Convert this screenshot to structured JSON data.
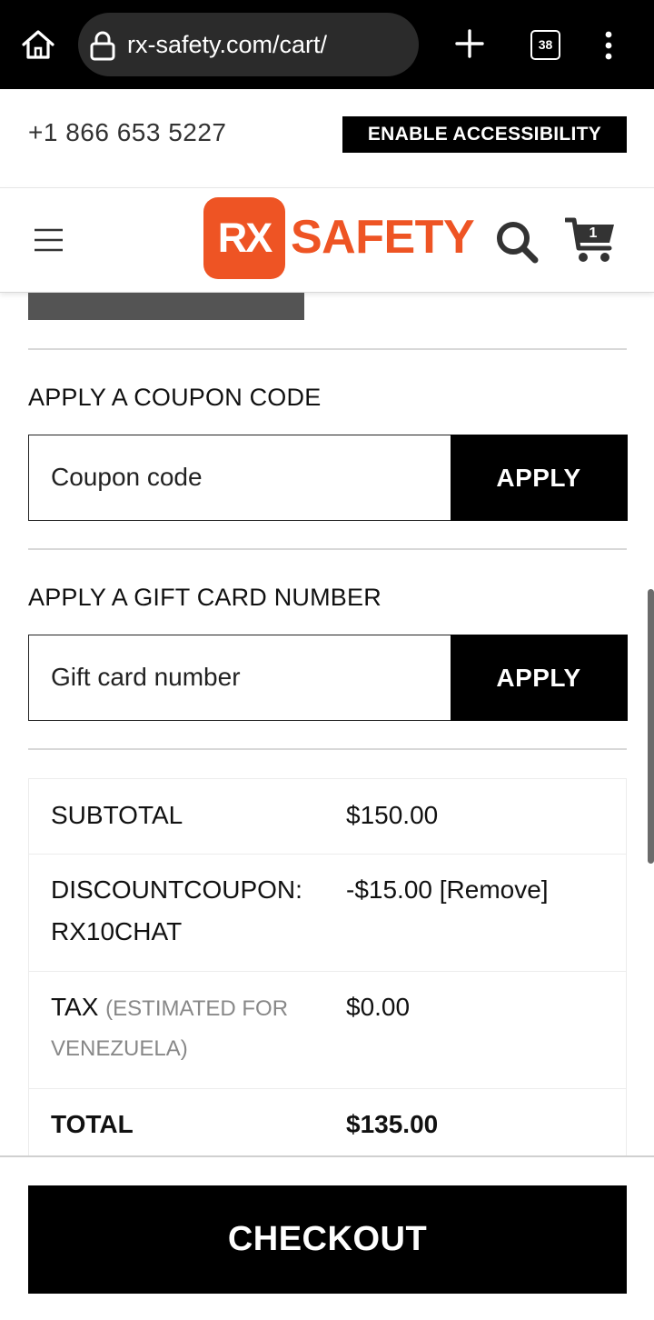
{
  "browser": {
    "url": "rx-safety.com/cart/",
    "tab_count": "38",
    "icons": {
      "home": "home-icon",
      "lock": "lock-icon",
      "new_tab": "plus-icon",
      "tabs": "tabs-icon",
      "menu": "kebab-menu-icon"
    }
  },
  "topbar": {
    "phone": "+1 866 653 5227",
    "accessibility_label": "ENABLE ACCESSIBILITY"
  },
  "header": {
    "logo_badge": "RX",
    "logo_text": "SAFETY",
    "cart_count": "1",
    "brand_color": "#ee5424",
    "icons": {
      "menu": "hamburger-icon",
      "search": "search-icon",
      "cart": "cart-icon"
    }
  },
  "coupon": {
    "label": "APPLY A COUPON CODE",
    "placeholder": "Coupon code",
    "value": "",
    "button_label": "APPLY"
  },
  "gift_card": {
    "label": "APPLY A GIFT CARD NUMBER",
    "placeholder": "Gift card number",
    "value": "",
    "button_label": "APPLY"
  },
  "totals": {
    "subtotal": {
      "label": "SUBTOTAL",
      "value": "$150.00"
    },
    "discount": {
      "label_line1": "DISCOUNTCOUPON:",
      "label_line2": "RX10CHAT",
      "value": "-$15.00",
      "remove_label": "[Remove]"
    },
    "tax": {
      "label": "TAX",
      "note_line1": "(ESTIMATED FOR",
      "note_line2": "VENEZUELA)",
      "value": "$0.00"
    },
    "total": {
      "label": "TOTAL",
      "value": "$135.00"
    }
  },
  "checkout": {
    "label": "CHECKOUT"
  }
}
